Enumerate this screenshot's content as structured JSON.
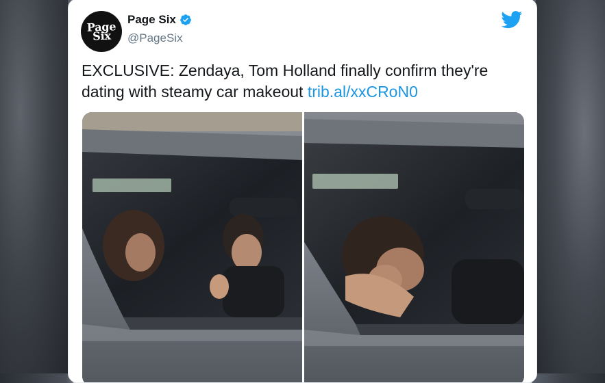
{
  "tweet": {
    "display_name": "Page Six",
    "handle": "@PageSix",
    "avatar_text": "Page\nSix",
    "text": "EXCLUSIVE: Zendaya, Tom Holland finally confirm they're dating with steamy car makeout ",
    "link_text": "trib.al/xxCRoN0"
  },
  "icons": {
    "verified": "verified-badge-icon",
    "platform": "twitter-bird-icon"
  },
  "colors": {
    "text_primary": "#14171a",
    "text_secondary": "#657786",
    "link": "#1b95e0",
    "verified": "#1da1f2",
    "twitter_blue": "#1da1f2"
  },
  "media": {
    "photo_count": 2
  }
}
